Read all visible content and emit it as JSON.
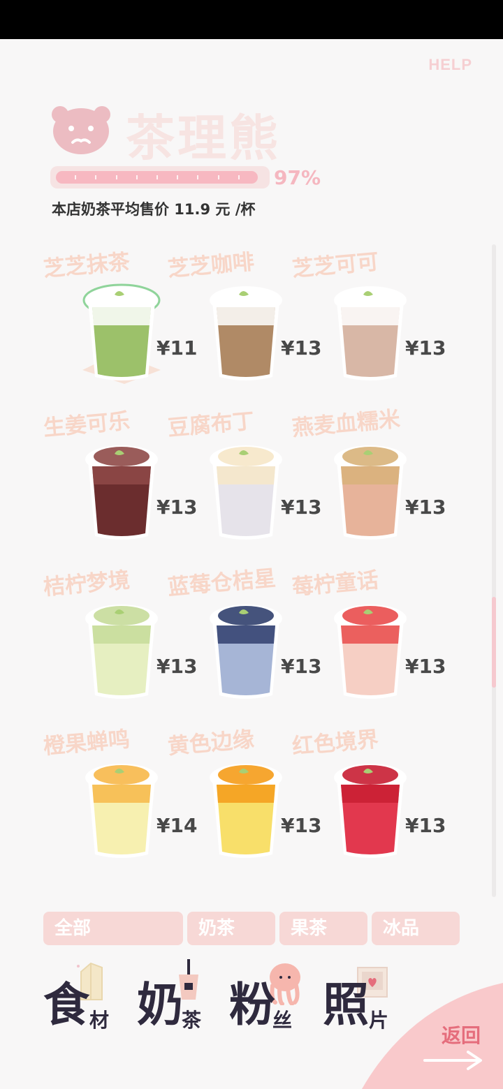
{
  "help_label": "HELP",
  "shop_title": "茶理熊",
  "progress": {
    "percent_label": "97%",
    "value": 0.97
  },
  "avg_price_text": "本店奶茶平均售价 11.9 元 /杯",
  "drinks": [
    {
      "name": "芝芝抹茶",
      "price": "¥11",
      "selected": true,
      "colors": {
        "body": "#9cc16a",
        "top": "#ffffff"
      }
    },
    {
      "name": "芝芝咖啡",
      "price": "¥13",
      "colors": {
        "body": "#b08a66",
        "top": "#ffffff"
      }
    },
    {
      "name": "芝芝可可",
      "price": "¥13",
      "colors": {
        "body": "#d8b7a6",
        "top": "#ffffff"
      }
    },
    {
      "name": "生姜可乐",
      "price": "¥13",
      "colors": {
        "body": "#6b2d2e",
        "top": "#8f4a48"
      }
    },
    {
      "name": "豆腐布丁",
      "price": "¥13",
      "colors": {
        "body": "#e6e3ea",
        "top": "#f6e7c8"
      }
    },
    {
      "name": "燕麦血糯米",
      "price": "¥13",
      "colors": {
        "body": "#e7b39a",
        "top": "#d8b27a"
      }
    },
    {
      "name": "桔柠梦境",
      "price": "¥13",
      "colors": {
        "body": "#e6efc1",
        "top": "#c6dc9a"
      }
    },
    {
      "name": "蓝莓仓桔星",
      "price": "¥13",
      "colors": {
        "body": "#a6b5d6",
        "top": "#31406e"
      }
    },
    {
      "name": "莓柠童话",
      "price": "¥13",
      "colors": {
        "body": "#f6cfc4",
        "top": "#e94c4c"
      }
    },
    {
      "name": "橙果蝉鸣",
      "price": "¥14",
      "colors": {
        "body": "#f7f0b0",
        "top": "#f7b84a"
      }
    },
    {
      "name": "黄色边缘",
      "price": "¥13",
      "colors": {
        "body": "#f8df6a",
        "top": "#f59c1a"
      }
    },
    {
      "name": "红色境界",
      "price": "¥13",
      "colors": {
        "body": "#e2384e",
        "top": "#c81e33"
      }
    }
  ],
  "filter_tabs": [
    "全部",
    "奶茶",
    "果茶",
    "冰品"
  ],
  "bottom_nav": [
    {
      "big": "食",
      "small": "材",
      "icon": "milk-carton-icon"
    },
    {
      "big": "奶",
      "small": "茶",
      "icon": "boba-cup-icon"
    },
    {
      "big": "粉",
      "small": "丝",
      "icon": "octopus-fan-icon"
    },
    {
      "big": "照",
      "small": "片",
      "icon": "photo-frame-icon"
    }
  ],
  "back_label": "返回",
  "colors": {
    "accent_pink": "#f5b7c0",
    "back_text": "#e56d7c",
    "nav_text": "#2f2a3e"
  }
}
